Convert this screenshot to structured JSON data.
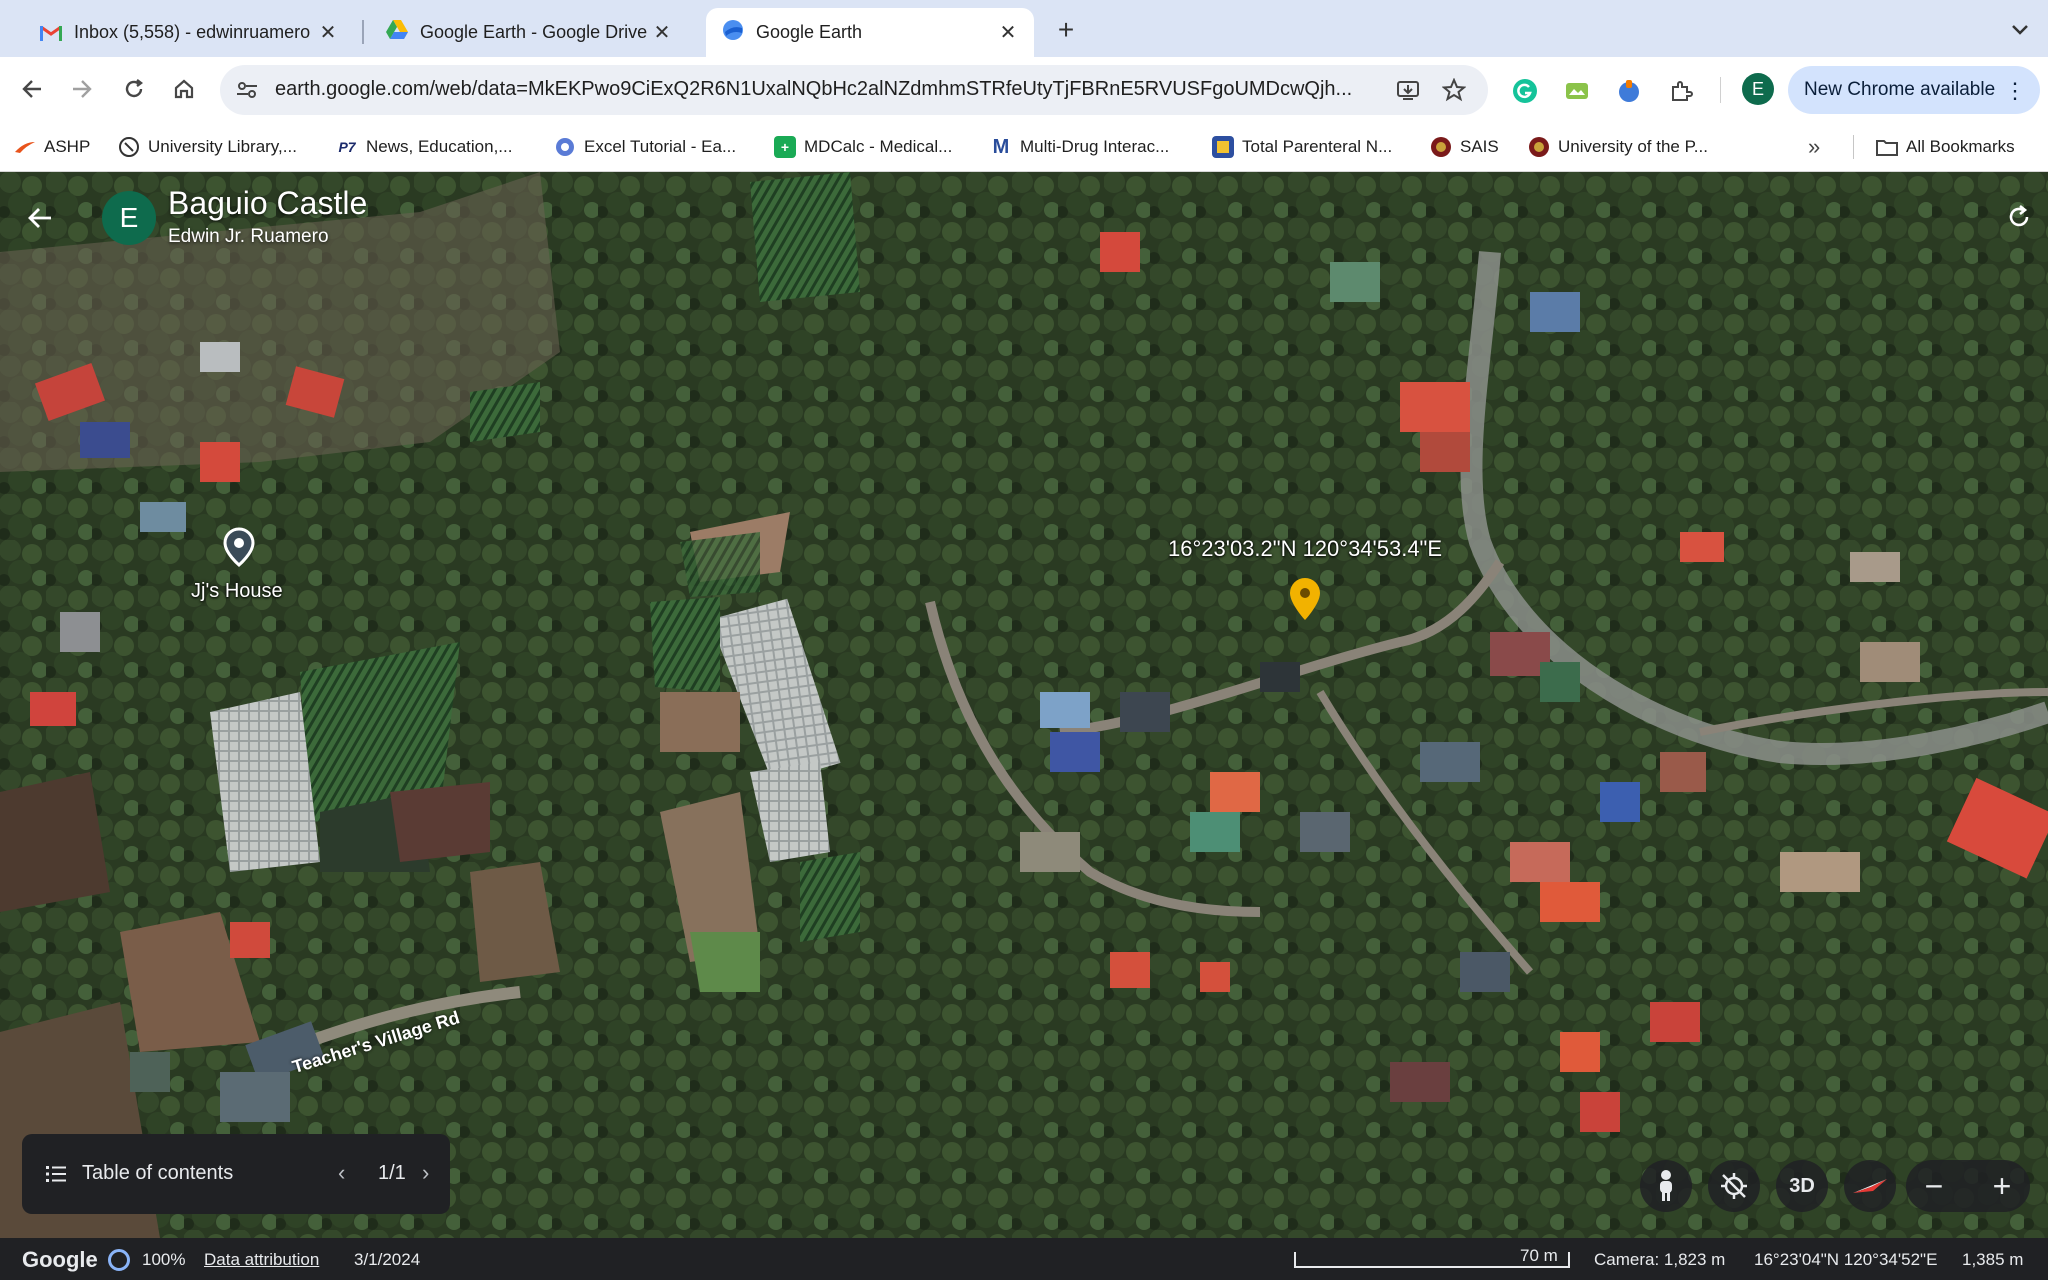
{
  "tabs": [
    {
      "title": "Inbox (5,558) - edwinruamero",
      "icon": "gmail-icon",
      "active": false
    },
    {
      "title": "Google Earth - Google Drive",
      "icon": "google-drive-icon",
      "active": false
    },
    {
      "title": "Google Earth",
      "icon": "google-earth-icon",
      "active": true
    }
  ],
  "toolbar": {
    "url": "earth.google.com/web/data=MkEKPwo9CiExQ2R6N1UxalNQbHc2alNZdmhmSTRfeUtyTjFBRnE5RVUSFgoUMDcwQjh...",
    "profile_initial": "E",
    "new_chrome_label": "New Chrome available"
  },
  "bookmarks": [
    {
      "label": "ASHP",
      "icon": "ashp-icon"
    },
    {
      "label": "University Library,...",
      "icon": "library-icon"
    },
    {
      "label": "News, Education,...",
      "icon": "news-icon"
    },
    {
      "label": "Excel Tutorial - Ea...",
      "icon": "excel-tutorial-icon"
    },
    {
      "label": "MDCalc - Medical...",
      "icon": "mdcalc-icon"
    },
    {
      "label": "Multi-Drug Interac...",
      "icon": "multi-drug-icon"
    },
    {
      "label": "Total Parenteral N...",
      "icon": "tpn-icon"
    },
    {
      "label": "SAIS",
      "icon": "sais-icon"
    },
    {
      "label": "University of the P...",
      "icon": "up-icon"
    }
  ],
  "all_bookmarks_label": "All Bookmarks",
  "project": {
    "avatar_initial": "E",
    "title": "Baguio Castle",
    "owner": "Edwin Jr. Ruamero"
  },
  "map": {
    "placemark_label": "Jj's House",
    "coordinate_label": "16°23'03.2\"N 120°34'53.4\"E",
    "road_label": "Teacher's Village Rd",
    "pin_color": "#f2b200"
  },
  "toc": {
    "label": "Table of contents",
    "page": "1/1"
  },
  "controls": {
    "threed_label": "3D"
  },
  "footer": {
    "brand": "Google",
    "load_percent": "100%",
    "data_attribution": "Data attribution",
    "imagery_date": "3/1/2024",
    "scale_label": "70 m",
    "camera": "Camera: 1,823 m",
    "cursor_coords": "16°23'04\"N 120°34'52\"E",
    "elevation": "1,385 m"
  }
}
